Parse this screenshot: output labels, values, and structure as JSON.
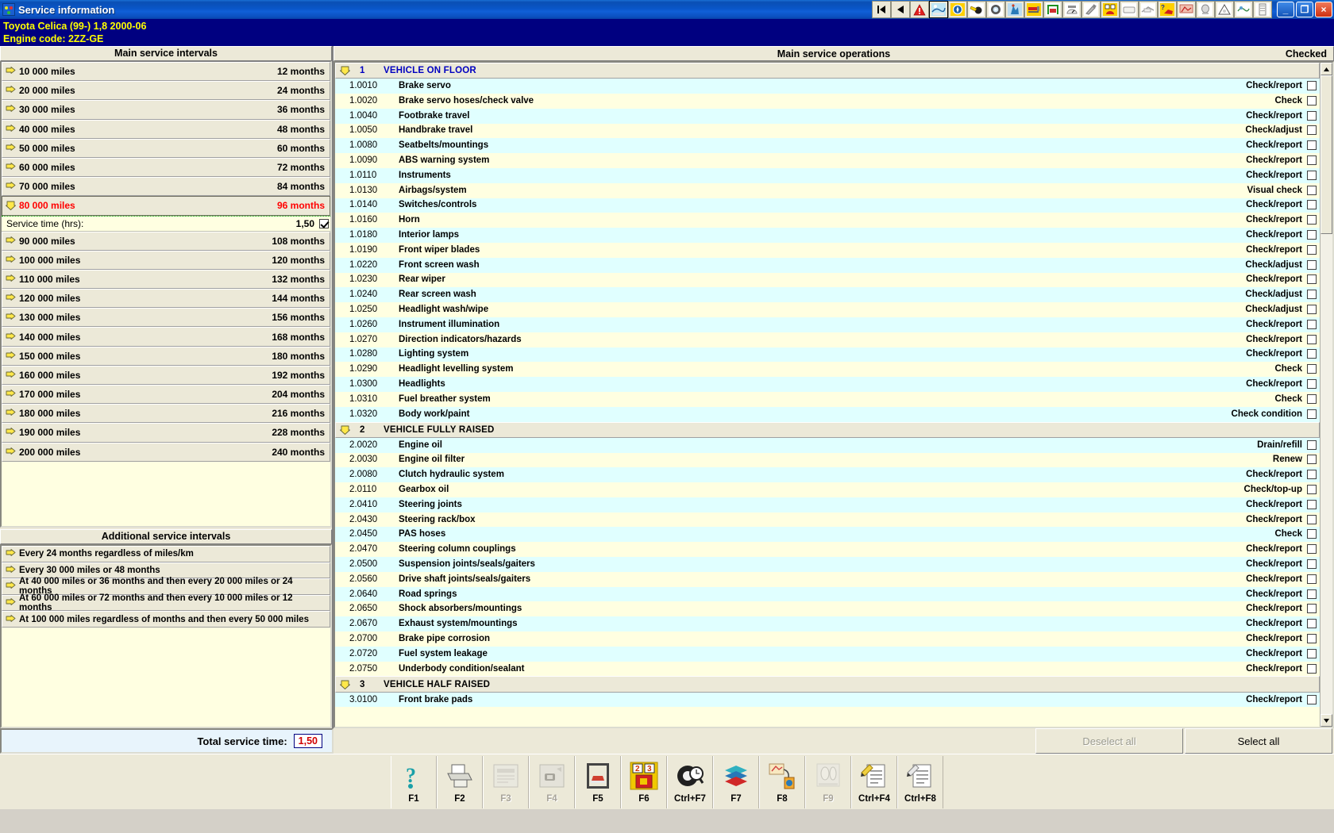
{
  "window": {
    "title": "Service information",
    "icon": "app-icon",
    "minimize_label": "_",
    "maximize_label": "❐",
    "close_label": "×"
  },
  "toolbar": {
    "buttons": [
      {
        "name": "first-record",
        "glyph": "⏮"
      },
      {
        "name": "previous-record",
        "glyph": "◀"
      },
      {
        "name": "warning",
        "glyph": "⚠"
      },
      {
        "name": "service-information",
        "glyph": "⚒"
      },
      {
        "name": "technical-data",
        "glyph": "◑"
      },
      {
        "name": "adjustments",
        "glyph": "⚙"
      },
      {
        "name": "wheel-alignment",
        "glyph": "◎"
      },
      {
        "name": "diagnostics",
        "glyph": "⚙"
      },
      {
        "name": "timing-belt",
        "glyph": "⟳"
      },
      {
        "name": "lifting-points",
        "glyph": "⛱"
      },
      {
        "name": "tyre-pressure",
        "glyph": "●"
      },
      {
        "name": "brake-data",
        "glyph": "✎"
      },
      {
        "name": "electrical-fuses",
        "glyph": "≡"
      },
      {
        "name": "air-conditioning",
        "glyph": "❄"
      },
      {
        "name": "wiring-diagram",
        "glyph": "⚡"
      },
      {
        "name": "engine-management",
        "glyph": "⚙"
      },
      {
        "name": "repair-times",
        "glyph": "⏱"
      },
      {
        "name": "warning-lamps",
        "glyph": "⚠"
      },
      {
        "name": "body-repair",
        "glyph": "⚒"
      },
      {
        "name": "vehicle-records",
        "glyph": "☰"
      }
    ]
  },
  "vehicle": {
    "line1": "Toyota   Celica (99-) 1,8  2000-06",
    "line2": "Engine code: 2ZZ-GE"
  },
  "left": {
    "main_title": "Main service intervals",
    "intervals": [
      {
        "miles": "10 000 miles",
        "months": "12 months",
        "selected": false
      },
      {
        "miles": "20 000 miles",
        "months": "24 months",
        "selected": false
      },
      {
        "miles": "30 000 miles",
        "months": "36 months",
        "selected": false
      },
      {
        "miles": "40 000 miles",
        "months": "48 months",
        "selected": false
      },
      {
        "miles": "50 000 miles",
        "months": "60 months",
        "selected": false
      },
      {
        "miles": "60 000 miles",
        "months": "72 months",
        "selected": false
      },
      {
        "miles": "70 000 miles",
        "months": "84 months",
        "selected": false
      },
      {
        "miles": "80 000 miles",
        "months": "96 months",
        "selected": true
      },
      {
        "miles": "90 000 miles",
        "months": "108 months",
        "selected": false
      },
      {
        "miles": "100 000 miles",
        "months": "120 months",
        "selected": false
      },
      {
        "miles": "110 000 miles",
        "months": "132 months",
        "selected": false
      },
      {
        "miles": "120 000 miles",
        "months": "144 months",
        "selected": false
      },
      {
        "miles": "130 000 miles",
        "months": "156 months",
        "selected": false
      },
      {
        "miles": "140 000 miles",
        "months": "168 months",
        "selected": false
      },
      {
        "miles": "150 000 miles",
        "months": "180 months",
        "selected": false
      },
      {
        "miles": "160 000 miles",
        "months": "192 months",
        "selected": false
      },
      {
        "miles": "170 000 miles",
        "months": "204 months",
        "selected": false
      },
      {
        "miles": "180 000 miles",
        "months": "216 months",
        "selected": false
      },
      {
        "miles": "190 000 miles",
        "months": "228 months",
        "selected": false
      },
      {
        "miles": "200 000 miles",
        "months": "240 months",
        "selected": false
      }
    ],
    "service_time": {
      "label": "Service time (hrs):",
      "value": "1,50",
      "checked": true
    },
    "additional_title": "Additional service intervals",
    "additional": [
      "Every 24 months regardless of miles/km",
      "Every 30 000 miles or 48 months",
      "At 40 000 miles or 36 months and then every 20 000 miles or 24 months",
      "At 60 000 miles or 72 months and then every 10 000 miles or 12 months",
      "At 100 000 miles regardless of months and then every 50 000 miles"
    ]
  },
  "right": {
    "title": "Main service operations",
    "checked_label": "Checked",
    "groups": [
      {
        "num": "1",
        "name": "VEHICLE ON FLOOR",
        "operations": [
          {
            "code": "1.0010",
            "name": "Brake servo",
            "action": "Check/report",
            "checked": false
          },
          {
            "code": "1.0020",
            "name": "Brake servo hoses/check valve",
            "action": "Check",
            "checked": false
          },
          {
            "code": "1.0040",
            "name": "Footbrake travel",
            "action": "Check/report",
            "checked": false
          },
          {
            "code": "1.0050",
            "name": "Handbrake travel",
            "action": "Check/adjust",
            "checked": false
          },
          {
            "code": "1.0080",
            "name": "Seatbelts/mountings",
            "action": "Check/report",
            "checked": false
          },
          {
            "code": "1.0090",
            "name": "ABS warning system",
            "action": "Check/report",
            "checked": false
          },
          {
            "code": "1.0110",
            "name": "Instruments",
            "action": "Check/report",
            "checked": false
          },
          {
            "code": "1.0130",
            "name": "Airbags/system",
            "action": "Visual check",
            "checked": false
          },
          {
            "code": "1.0140",
            "name": "Switches/controls",
            "action": "Check/report",
            "checked": false
          },
          {
            "code": "1.0160",
            "name": "Horn",
            "action": "Check/report",
            "checked": false
          },
          {
            "code": "1.0180",
            "name": "Interior lamps",
            "action": "Check/report",
            "checked": false
          },
          {
            "code": "1.0190",
            "name": "Front wiper blades",
            "action": "Check/report",
            "checked": false
          },
          {
            "code": "1.0220",
            "name": "Front screen wash",
            "action": "Check/adjust",
            "checked": false
          },
          {
            "code": "1.0230",
            "name": "Rear wiper",
            "action": "Check/report",
            "checked": false
          },
          {
            "code": "1.0240",
            "name": "Rear screen wash",
            "action": "Check/adjust",
            "checked": false
          },
          {
            "code": "1.0250",
            "name": "Headlight wash/wipe",
            "action": "Check/adjust",
            "checked": false
          },
          {
            "code": "1.0260",
            "name": "Instrument illumination",
            "action": "Check/report",
            "checked": false
          },
          {
            "code": "1.0270",
            "name": "Direction indicators/hazards",
            "action": "Check/report",
            "checked": false
          },
          {
            "code": "1.0280",
            "name": "Lighting system",
            "action": "Check/report",
            "checked": false
          },
          {
            "code": "1.0290",
            "name": "Headlight levelling system",
            "action": "Check",
            "checked": false
          },
          {
            "code": "1.0300",
            "name": "Headlights",
            "action": "Check/report",
            "checked": false
          },
          {
            "code": "1.0310",
            "name": "Fuel breather system",
            "action": "Check",
            "checked": false
          },
          {
            "code": "1.0320",
            "name": "Body work/paint",
            "action": "Check condition",
            "checked": false
          }
        ]
      },
      {
        "num": "2",
        "name": "VEHICLE FULLY RAISED",
        "operations": [
          {
            "code": "2.0020",
            "name": "Engine oil",
            "action": "Drain/refill",
            "checked": false
          },
          {
            "code": "2.0030",
            "name": "Engine oil filter",
            "action": "Renew",
            "checked": false
          },
          {
            "code": "2.0080",
            "name": "Clutch hydraulic system",
            "action": "Check/report",
            "checked": false
          },
          {
            "code": "2.0110",
            "name": "Gearbox oil",
            "action": "Check/top-up",
            "checked": false
          },
          {
            "code": "2.0410",
            "name": "Steering joints",
            "action": "Check/report",
            "checked": false
          },
          {
            "code": "2.0430",
            "name": "Steering rack/box",
            "action": "Check/report",
            "checked": false
          },
          {
            "code": "2.0450",
            "name": "PAS hoses",
            "action": "Check",
            "checked": false
          },
          {
            "code": "2.0470",
            "name": "Steering column couplings",
            "action": "Check/report",
            "checked": false
          },
          {
            "code": "2.0500",
            "name": "Suspension joints/seals/gaiters",
            "action": "Check/report",
            "checked": false
          },
          {
            "code": "2.0560",
            "name": "Drive shaft joints/seals/gaiters",
            "action": "Check/report",
            "checked": false
          },
          {
            "code": "2.0640",
            "name": "Road springs",
            "action": "Check/report",
            "checked": false
          },
          {
            "code": "2.0650",
            "name": "Shock absorbers/mountings",
            "action": "Check/report",
            "checked": false
          },
          {
            "code": "2.0670",
            "name": "Exhaust system/mountings",
            "action": "Check/report",
            "checked": false
          },
          {
            "code": "2.0700",
            "name": "Brake pipe corrosion",
            "action": "Check/report",
            "checked": false
          },
          {
            "code": "2.0720",
            "name": "Fuel system leakage",
            "action": "Check/report",
            "checked": false
          },
          {
            "code": "2.0750",
            "name": "Underbody condition/sealant",
            "action": "Check/report",
            "checked": false
          }
        ]
      },
      {
        "num": "3",
        "name": "VEHICLE HALF RAISED",
        "operations": [
          {
            "code": "3.0100",
            "name": "Front brake pads",
            "action": "Check/report",
            "checked": false
          }
        ]
      }
    ]
  },
  "footer": {
    "total_label": "Total service time:",
    "total_value": "1,50",
    "deselect_all": "Deselect all",
    "select_all": "Select all"
  },
  "fkeys": [
    {
      "label": "F1",
      "icon": "help-icon",
      "glyph": "?",
      "dim": false
    },
    {
      "label": "F2",
      "icon": "print-icon",
      "glyph": "⎙",
      "dim": false
    },
    {
      "label": "F3",
      "icon": "document-icon",
      "glyph": "▤",
      "dim": true
    },
    {
      "label": "F4",
      "icon": "scanner-icon",
      "glyph": "⛏",
      "dim": true
    },
    {
      "label": "F5",
      "icon": "vehicle-lift-icon",
      "glyph": "⛟",
      "dim": false
    },
    {
      "label": "F6",
      "icon": "service-plan-icon",
      "glyph": "▦",
      "dim": false
    },
    {
      "label": "Ctrl+F7",
      "icon": "tyre-icon",
      "glyph": "●",
      "dim": false
    },
    {
      "label": "F7",
      "icon": "books-icon",
      "glyph": "▤",
      "dim": false
    },
    {
      "label": "F8",
      "icon": "labels-icon",
      "glyph": "✇",
      "dim": false
    },
    {
      "label": "F9",
      "icon": "oval-icon",
      "glyph": "◯",
      "dim": true
    },
    {
      "label": "Ctrl+F4",
      "icon": "edit-report-icon",
      "glyph": "✍",
      "dim": false
    },
    {
      "label": "Ctrl+F8",
      "icon": "new-report-icon",
      "glyph": "✎",
      "dim": false
    }
  ]
}
